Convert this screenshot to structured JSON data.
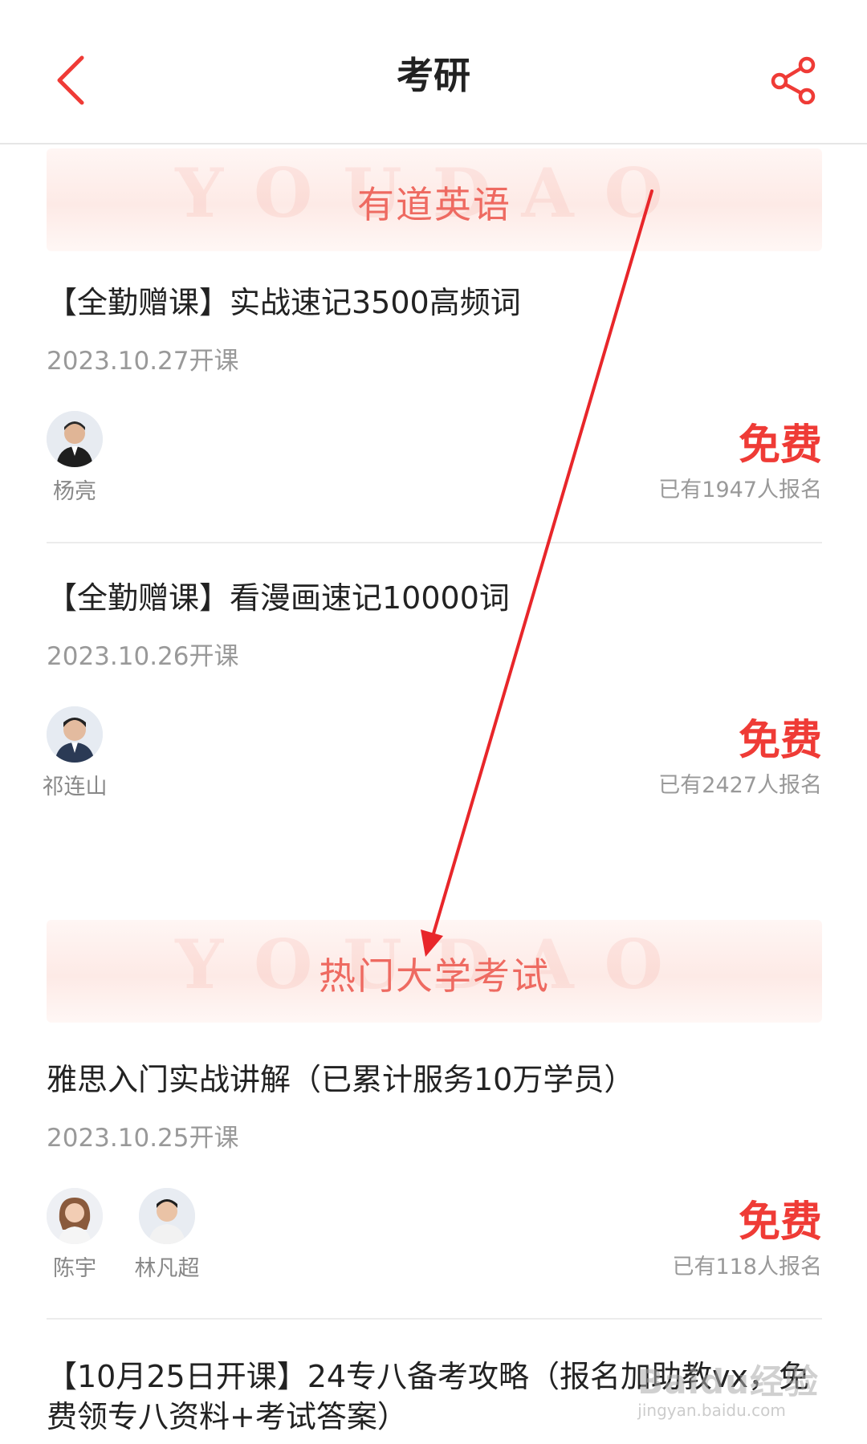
{
  "header": {
    "title": "考研"
  },
  "sections": [
    {
      "banner_title": "有道英语",
      "banner_watermark": "YOUDAO"
    },
    {
      "banner_title": "热门大学考试",
      "banner_watermark": "YOUDAO"
    }
  ],
  "courses": [
    {
      "title": "【全勤赠课】实战速记3500高频词",
      "date": "2023.10.27开课",
      "teachers": [
        "杨亮"
      ],
      "price": "免费",
      "signup": "已有1947人报名"
    },
    {
      "title": "【全勤赠课】看漫画速记10000词",
      "date": "2023.10.26开课",
      "teachers": [
        "祁连山"
      ],
      "price": "免费",
      "signup": "已有2427人报名"
    },
    {
      "title": "雅思入门实战讲解（已累计服务10万学员）",
      "date": "2023.10.25开课",
      "teachers": [
        "陈宇",
        "林凡超"
      ],
      "price": "免费",
      "signup": "已有118人报名"
    },
    {
      "title": "【10月25日开课】24专八备考攻略（报名加助教vx，免费领专八资料+考试答案）"
    }
  ],
  "watermark": {
    "main": "Baidu经验",
    "sub": "jingyan.baidu.com"
  },
  "colors": {
    "accent": "#ef3b36",
    "banner_text": "#ee6a61",
    "annotation_arrow": "#e8262a"
  },
  "icons": {
    "back": "chevron-left-icon",
    "share": "share-icon"
  }
}
